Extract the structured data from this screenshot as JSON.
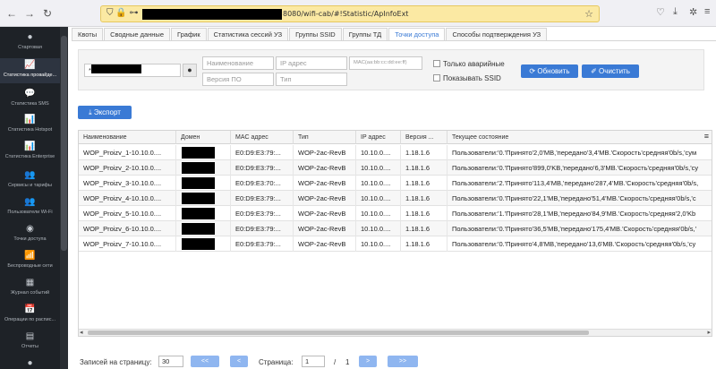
{
  "browser": {
    "url_text": "8080/wifi-cab/#!Statistic/ApInfoExt"
  },
  "sidebar": {
    "items": [
      {
        "label": "Стартовая",
        "icon": "●"
      },
      {
        "label": "Статистика провайде...",
        "icon": "📈"
      },
      {
        "label": "Статистика SMS",
        "icon": "💬"
      },
      {
        "label": "Статистика Hotspot",
        "icon": "📊"
      },
      {
        "label": "Статистика Enterprise",
        "icon": "📊"
      },
      {
        "label": "Сервисы и тарифы",
        "icon": "👥"
      },
      {
        "label": "Пользователи Wi-Fi",
        "icon": "👥"
      },
      {
        "label": "Точки доступа",
        "icon": "◉"
      },
      {
        "label": "Беспроводные сети",
        "icon": "📶"
      },
      {
        "label": "Журнал событий",
        "icon": "▦"
      },
      {
        "label": "Операции по распис...",
        "icon": "📅"
      },
      {
        "label": "Отчеты",
        "icon": "▤"
      }
    ]
  },
  "tabs": [
    "Квоты",
    "Сводные данные",
    "График",
    "Статистика сессий УЗ",
    "Группы SSID",
    "Группы ТД",
    "Точки доступа",
    "Способы подтверждения УЗ"
  ],
  "filters": {
    "name_placeholder": "Наименование",
    "ip_placeholder": "IP адрес",
    "mac_placeholder": "MAC(aa:bb:cc:dd:ee:ff)",
    "po_placeholder": "Версия ПО",
    "type_placeholder": "Тип",
    "only_alarm_label": "Только аварийные",
    "show_ssid_label": "Показывать SSID",
    "refresh_label": "Обновить",
    "clear_label": "Очистить",
    "field_prefix": "*"
  },
  "export_label": "Экспорт",
  "grid": {
    "columns": [
      "Наименование",
      "Домен",
      "MAC адрес",
      "Тип",
      "IP адрес",
      "Версия ...",
      "Текущее состояние"
    ],
    "rows": [
      [
        "WOP_Proizv_1-10.10.0....",
        "",
        "E0:D9:E3:79:...",
        "WOP-2ac-RevB",
        "10.10.0....",
        "1.18.1.6",
        "Пользователи:'0.'Принято'2,0'MB,'передано'3,4'MB.'Скорость'средняя'0b/s,'сум"
      ],
      [
        "WOP_Proizv_2-10.10.0....",
        "",
        "E0:D9:E3:79:...",
        "WOP-2ac-RevB",
        "10.10.0....",
        "1.18.1.6",
        "Пользователи:'0.'Принято'899,0'KB,'передано'6,3'MB.'Скорость'средняя'0b/s,'су"
      ],
      [
        "WOP_Proizv_3-10.10.0....",
        "",
        "E0:D9:E3:70:...",
        "WOP-2ac-RevB",
        "10.10.0....",
        "1.18.1.6",
        "Пользователи:'2.'Принято'113,4'MB,'передано'287,4'MB.'Скорость'средняя'0b/s,"
      ],
      [
        "WOP_Proizv_4-10.10.0....",
        "",
        "E0:D9:E3:79:...",
        "WOP-2ac-RevB",
        "10.10.0....",
        "1.18.1.6",
        "Пользователи:'0.'Принято'22,1'MB,'передано'51,4'MB.'Скорость'средняя'0b/s,'c"
      ],
      [
        "WOP_Proizv_5-10.10.0....",
        "",
        "E0:D9:E3:79:...",
        "WOP-2ac-RevB",
        "10.10.0....",
        "1.18.1.6",
        "Пользователи:'1.'Принято'28,1'MB,'передано'84,9'MB.'Скорость'средняя'2,0'Kb"
      ],
      [
        "WOP_Proizv_6-10.10.0....",
        "",
        "E0:D9:E3:79:...",
        "WOP-2ac-RevB",
        "10.10.0....",
        "1.18.1.6",
        "Пользователи:'0.'Принято'36,5'MB,'передано'175,4'MB.'Скорость'средняя'0b/s,'"
      ],
      [
        "WOP_Proizv_7-10.10.0....",
        "",
        "E0:D9:E3:79:...",
        "WOP-2ac-RevB",
        "10.10.0....",
        "1.18.1.6",
        "Пользователи:'0.'Принято'4,8'MB,'передано'13,6'MB.'Скорость'средняя'0b/s,'су"
      ]
    ]
  },
  "pager": {
    "per_page_label": "Записей на страницу:",
    "per_page_value": "30",
    "first_label": "<<",
    "prev_label": "<",
    "page_label": "Страница:",
    "page_value": "1",
    "of_label": "/",
    "total_pages": "1",
    "next_label": ">",
    "last_label": ">>"
  },
  "colors": {
    "accent": "#3a7ad5",
    "url_bar": "#fbe9a3",
    "sidebar": "#1e2227"
  }
}
